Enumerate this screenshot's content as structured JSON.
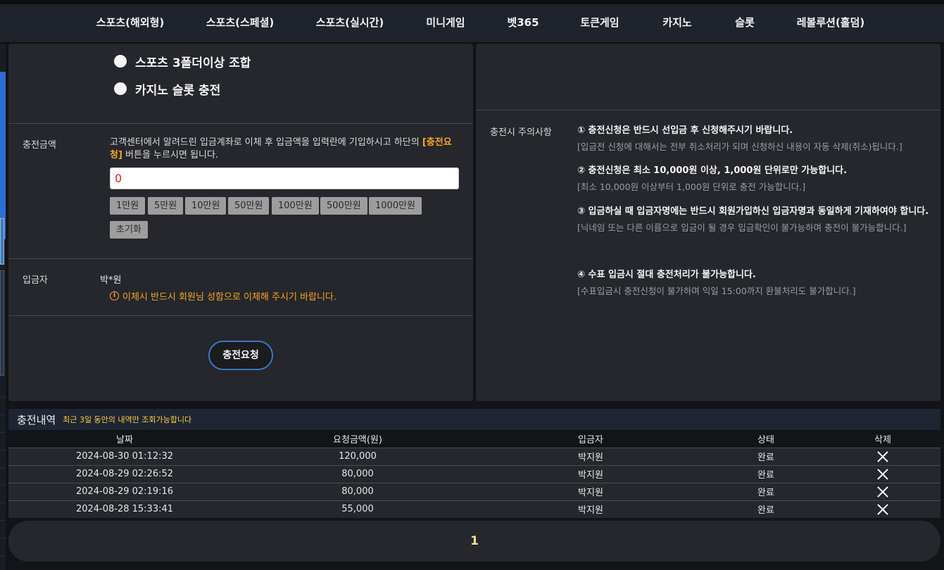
{
  "nav": [
    {
      "label": "스포츠(해외형)"
    },
    {
      "label": "스포츠(스페셜)"
    },
    {
      "label": "스포츠(실시간)"
    },
    {
      "label": "미니게임"
    },
    {
      "label": "벳365"
    },
    {
      "label": "토큰게임"
    },
    {
      "label": "카지노"
    },
    {
      "label": "슬롯"
    },
    {
      "label": "레볼루션(홀덤)"
    }
  ],
  "bonus_options": [
    {
      "label": "스포츠 3폴더이상 조합"
    },
    {
      "label": "카지노 슬롯 충전"
    }
  ],
  "amount": {
    "label": "충전금액",
    "desc_before": "고객센터에서 알려드린 입금계좌로 이체 후 입금액을 입력란에 기입하시고 하단의 ",
    "desc_highlight": "[충전요청]",
    "desc_after": " 버튼을 누르시면 됩니다.",
    "value": "0",
    "buttons": [
      "1만원",
      "5만원",
      "10만원",
      "50만원",
      "100만원",
      "500만원",
      "1000만원"
    ],
    "reset_label": "초기화"
  },
  "depositor": {
    "label": "입금자",
    "name": "박*원",
    "notice": "이체시 반드시 회원님 성함으로 이체해 주시기 바랍니다."
  },
  "submit_label": "충전요청",
  "notices": {
    "label": "충전시 주의사항",
    "items": [
      {
        "main": "① 충전신청은 반드시 선입금 후 신청해주시기 바랍니다.",
        "sub": "[입금전 신청에 대해서는 전부 취소처리가 되며 신청하신 내용이 자동 삭제(취소)됩니다.]"
      },
      {
        "main": "② 충전신청은 최소 10,000원 이상, 1,000원 단위로만 가능합니다.",
        "sub": "[최소 10,000원 이상부터 1,000원 단위로 충전 가능합니다.]"
      },
      {
        "main": "③ 입금하실 때 입금자명에는 반드시 회원가입하신 입금자명과 동일하게 기재하여야 합니다.",
        "sub": "[닉네임 또는 다른 이름으로 입금이 될 경우 입금확인이 불가능하며 충전이 불가능합니다.]"
      },
      {
        "main": "④ 수표 입금시 절대 충전처리가 불가능합니다.",
        "sub": "[수표입금시 충전신청이 불가하며 익일 15:00까지 환불처리도 불가합니다.]"
      }
    ]
  },
  "history": {
    "title": "충전내역",
    "note": "최근 3일 동안의 내역만 조회가능합니다",
    "columns": [
      "날짜",
      "요청금액(원)",
      "입금자",
      "상태",
      "삭제"
    ],
    "rows": [
      {
        "date": "2024-08-30 01:12:32",
        "amount": "120,000",
        "name": "박지원",
        "status": "완료"
      },
      {
        "date": "2024-08-29 02:26:52",
        "amount": "80,000",
        "name": "박지원",
        "status": "완료"
      },
      {
        "date": "2024-08-29 02:19:16",
        "amount": "80,000",
        "name": "박지원",
        "status": "완료"
      },
      {
        "date": "2024-08-28 15:33:41",
        "amount": "55,000",
        "name": "박지원",
        "status": "완료"
      }
    ]
  },
  "pagination": {
    "current": "1"
  },
  "icons": {
    "delete": "close-x-icon",
    "info": "info-circle-icon"
  }
}
